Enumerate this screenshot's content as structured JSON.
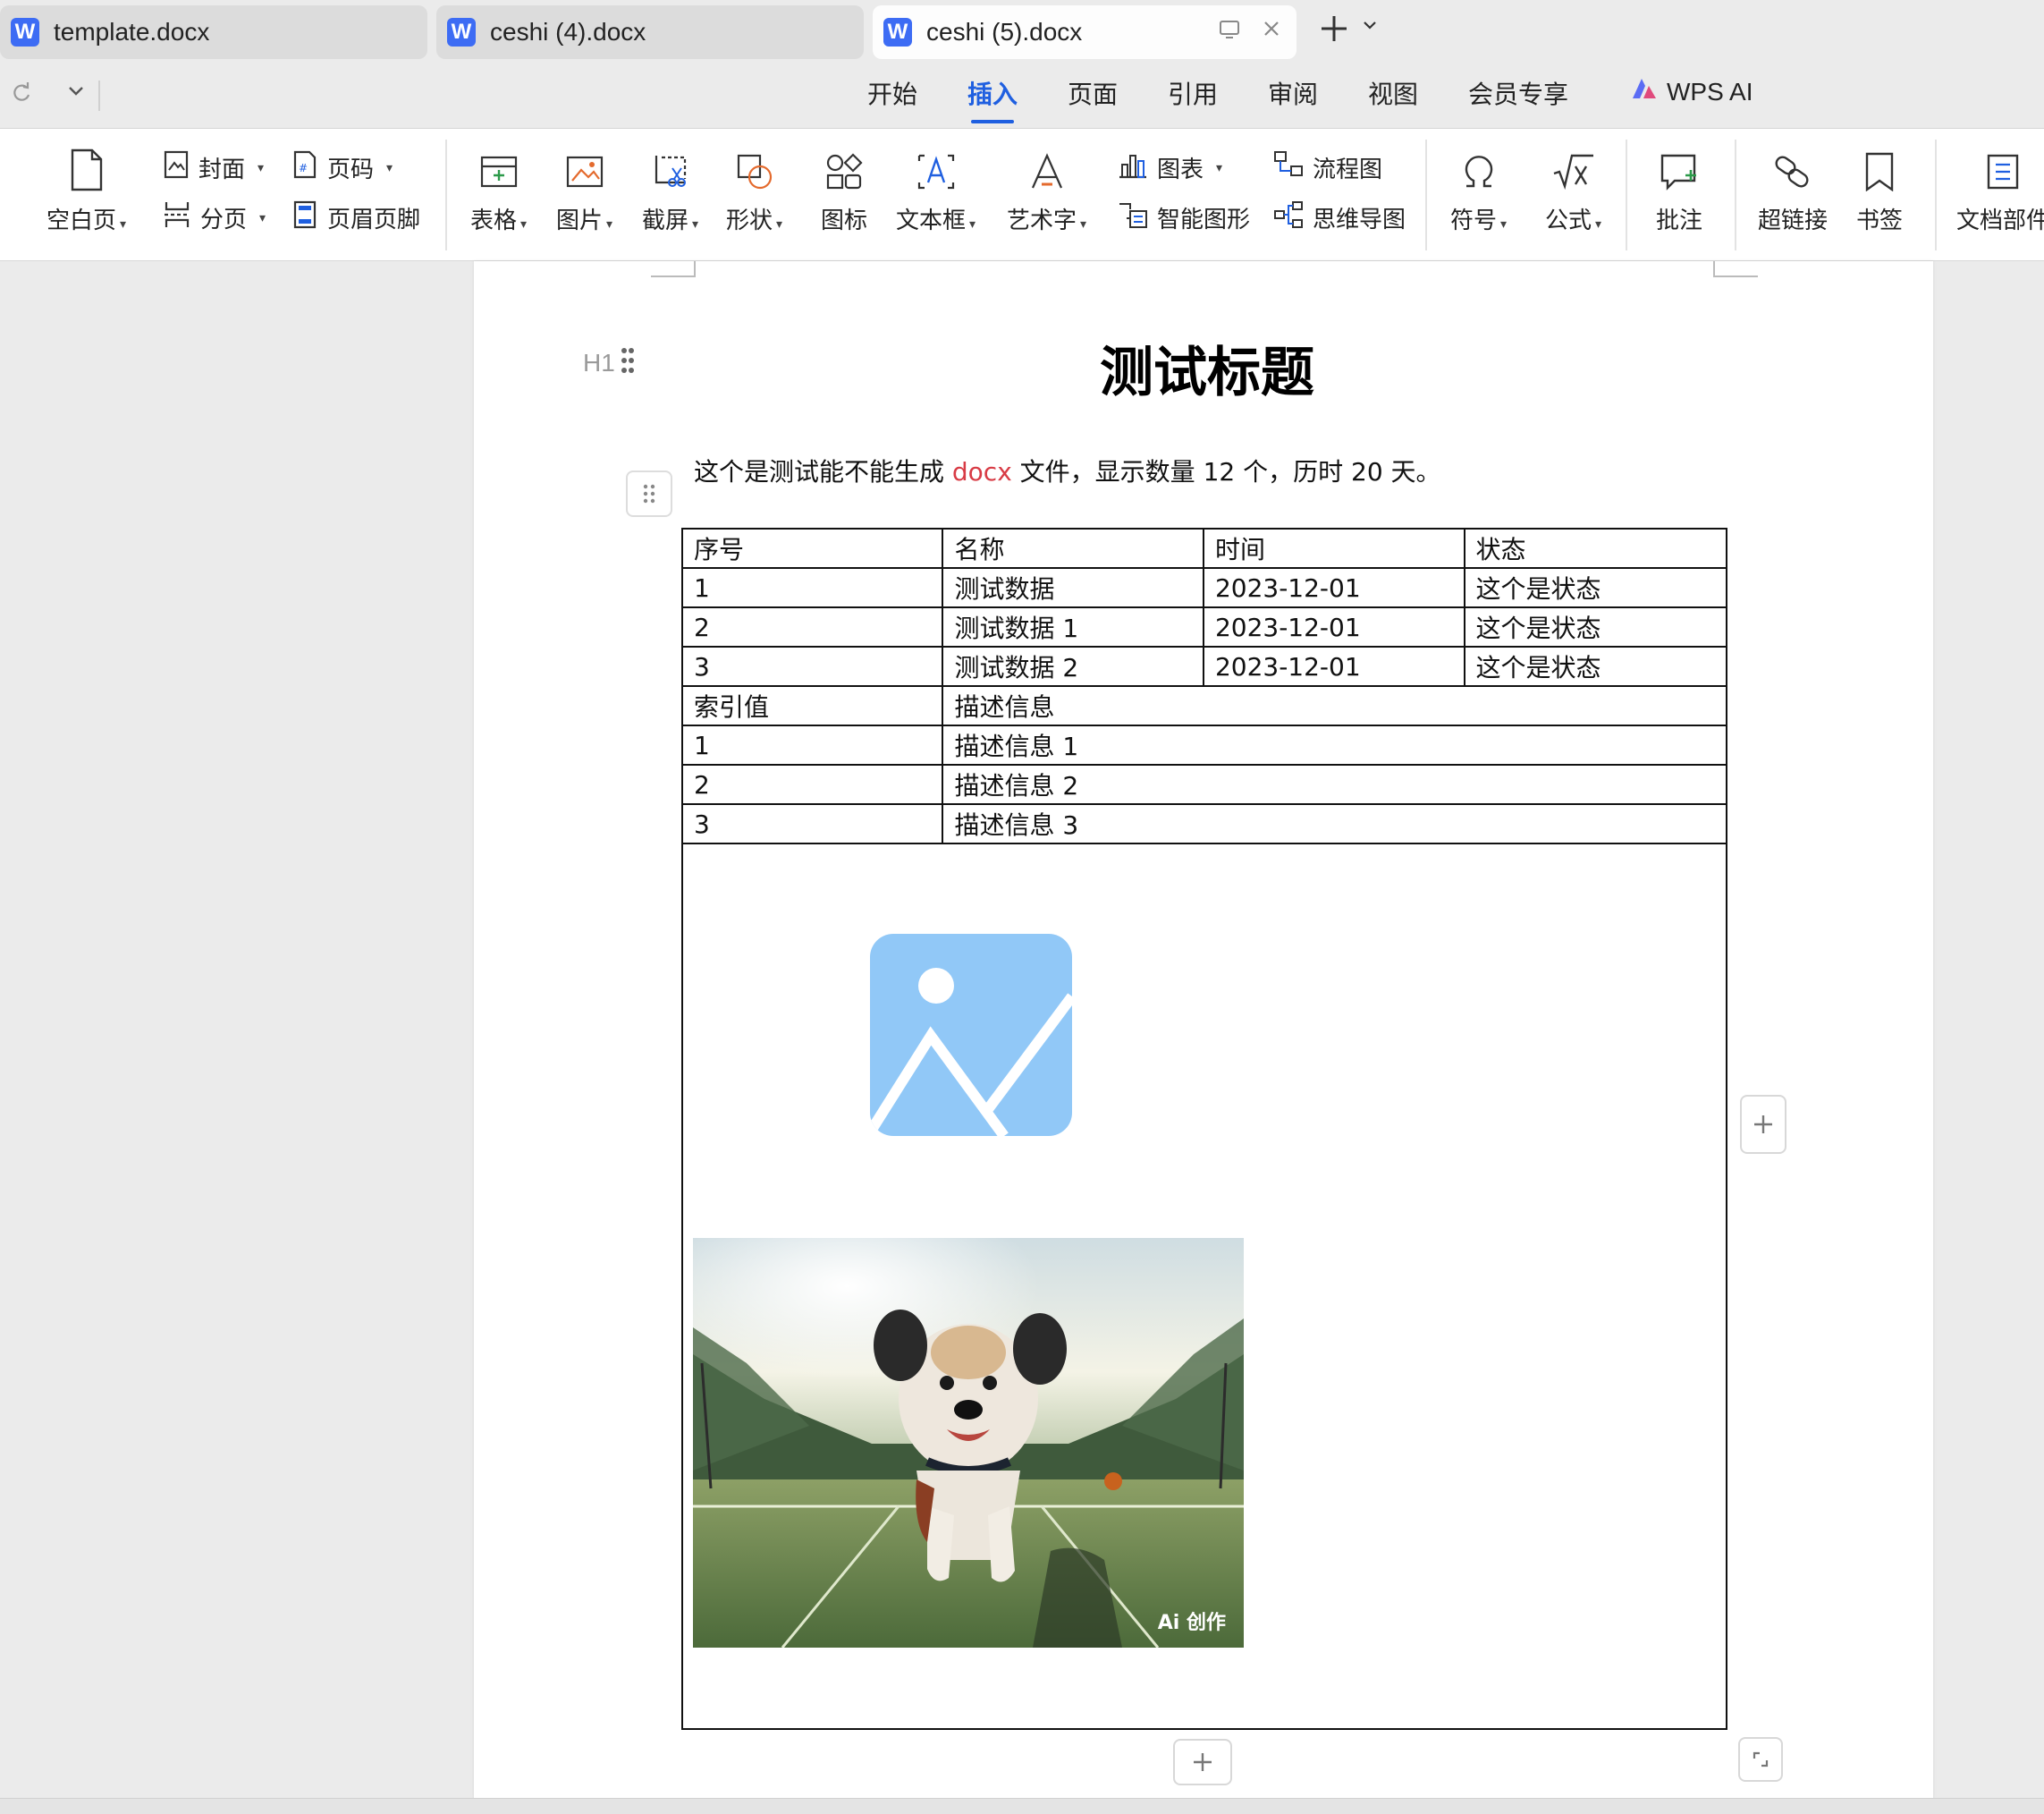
{
  "tabs": [
    {
      "title": "template.docx",
      "icon": "word-doc-icon"
    },
    {
      "title": "ceshi (4).docx",
      "icon": "word-doc-icon"
    },
    {
      "title": "ceshi (5).docx",
      "icon": "word-doc-icon",
      "active": true
    }
  ],
  "tab_icon_letter": "W",
  "menu": {
    "items": [
      "开始",
      "插入",
      "页面",
      "引用",
      "审阅",
      "视图",
      "会员专享"
    ],
    "active": "插入",
    "ai_label": "WPS AI"
  },
  "ribbon": {
    "blank_page": "空白页",
    "cover": "封面",
    "page_number": "页码",
    "page_break": "分页",
    "header_footer": "页眉页脚",
    "table": "表格",
    "picture": "图片",
    "screenshot": "截屏",
    "shape": "形状",
    "icon": "图标",
    "textbox": "文本框",
    "wordart": "艺术字",
    "chart": "图表",
    "smartart": "智能图形",
    "flowchart": "流程图",
    "mindmap": "思维导图",
    "symbol": "符号",
    "formula": "公式",
    "comment": "批注",
    "hyperlink": "超链接",
    "bookmark": "书签",
    "doc_parts": "文档部件"
  },
  "document": {
    "heading_hint": "H1",
    "title": "测试标题",
    "paragraph": {
      "before": "这个是测试能不能生成 ",
      "highlight": "docx",
      "after": " 文件，显示数量 12 个，历时 20 天。"
    },
    "table1": {
      "headers": [
        "序号",
        "名称",
        "时间",
        "状态"
      ],
      "rows": [
        [
          "1",
          "测试数据",
          "2023-12-01",
          "这个是状态"
        ],
        [
          "2",
          "测试数据 1",
          "2023-12-01",
          "这个是状态"
        ],
        [
          "3",
          "测试数据 2",
          "2023-12-01",
          "这个是状态"
        ]
      ]
    },
    "table2": {
      "headers": [
        "索引值",
        "描述信息"
      ],
      "rows": [
        [
          "1",
          "描述信息 1"
        ],
        [
          "2",
          "描述信息 2"
        ],
        [
          "3",
          "描述信息 3"
        ]
      ]
    },
    "photo_badge": "Ai 创作"
  },
  "colors": {
    "accent": "#1f5fe0",
    "highlight_red": "#d83b45",
    "placeholder_blue": "#91c8f7",
    "word_icon": "#3d6cf4"
  }
}
